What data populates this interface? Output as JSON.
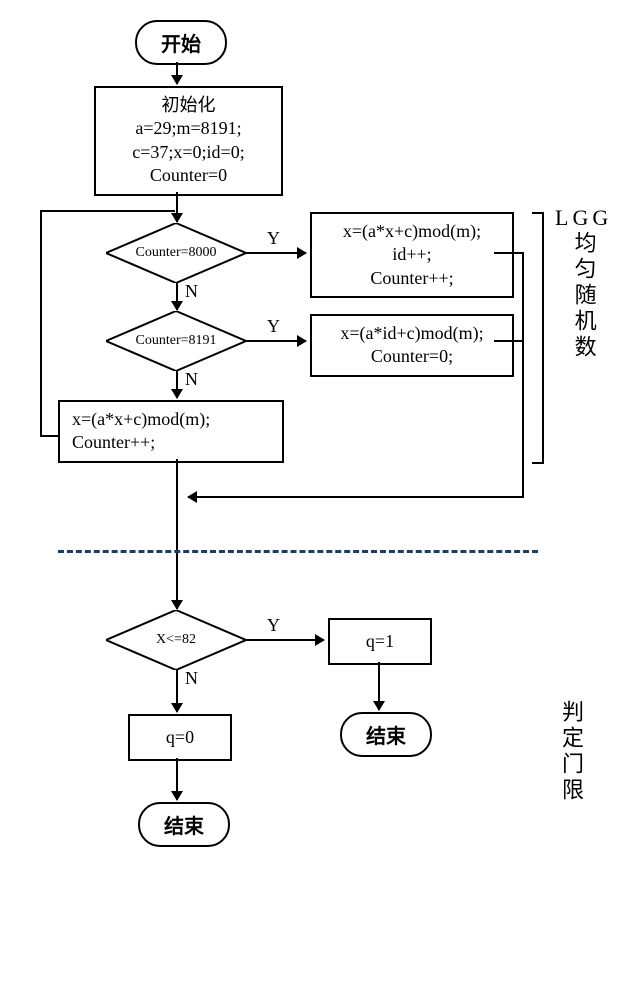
{
  "nodes": {
    "start": "开始",
    "init_title": "初始化",
    "init_l1": "a=29;m=8191;",
    "init_l2": "c=37;x=0;id=0;",
    "init_l3": "Counter=0",
    "dec1": "Counter=8000",
    "dec2": "Counter=8191",
    "proc_top_l1": "x=(a*x+c)mod(m);",
    "proc_top_l2": "id++;",
    "proc_top_l3": "Counter++;",
    "proc_mid_l1": "x=(a*id+c)mod(m);",
    "proc_mid_l2": "Counter=0;",
    "proc_left_l1": "x=(a*x+c)mod(m);",
    "proc_left_l2": "Counter++;",
    "dec3": "X<=82",
    "q1": "q=1",
    "q0": "q=0",
    "end1": "结束",
    "end2": "结束"
  },
  "labels": {
    "Y": "Y",
    "N": "N",
    "section1": "LGG均匀随机数",
    "section2": "判定门限"
  }
}
